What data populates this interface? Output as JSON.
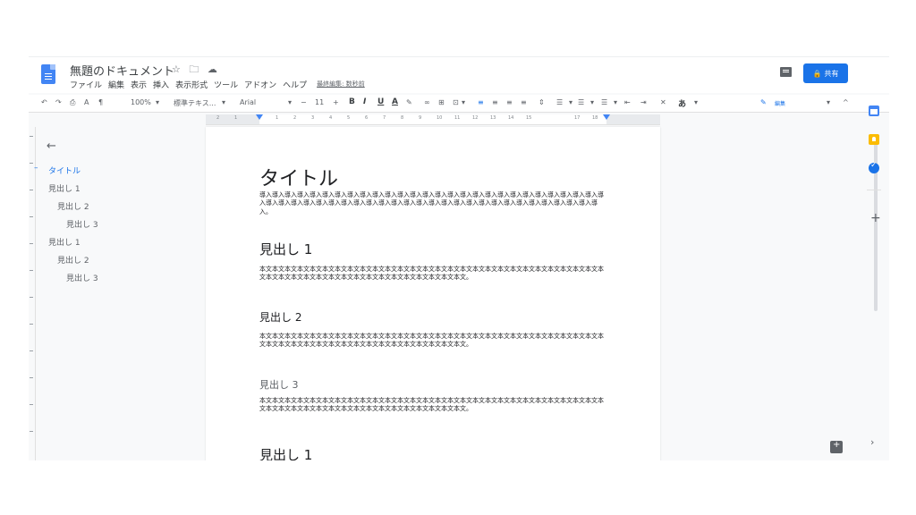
{
  "header": {
    "title": "無題のドキュメント",
    "star_icon": "☆",
    "folder_icon": "🗀",
    "cloud_icon": "☁",
    "menu": [
      "ファイル",
      "編集",
      "表示",
      "挿入",
      "表示形式",
      "ツール",
      "アドオン",
      "ヘルプ"
    ],
    "last_edit": "最終編集: 数秒前",
    "share_label": "共有",
    "accent_color": "#1a73e8"
  },
  "toolbar": {
    "zoom": "100%",
    "style": "標準テキス...",
    "font": "Arial",
    "font_size": "11",
    "bold": "B",
    "italic": "I",
    "underline": "U",
    "text_color": "A",
    "input_mode": "あ",
    "mode": "編集"
  },
  "ruler": {
    "numbers": [
      "2",
      "1",
      "1",
      "2",
      "3",
      "4",
      "5",
      "6",
      "7",
      "8",
      "9",
      "10",
      "11",
      "12",
      "13",
      "14",
      "15",
      "17",
      "18"
    ]
  },
  "outline": {
    "items": [
      {
        "label": "タイトル",
        "level": 0,
        "active": true
      },
      {
        "label": "見出し 1",
        "level": 1,
        "active": false
      },
      {
        "label": "見出し 2",
        "level": 2,
        "active": false
      },
      {
        "label": "見出し 3",
        "level": 3,
        "active": false
      },
      {
        "label": "見出し 1",
        "level": 1,
        "active": false
      },
      {
        "label": "見出し 2",
        "level": 2,
        "active": false
      },
      {
        "label": "見出し 3",
        "level": 3,
        "active": false
      }
    ]
  },
  "document": {
    "title": "タイトル",
    "title_body": "導入導入導入導入導入導入導入導入導入導入導入導入導入導入導入導入導入導入導入導入導入導入導入導入導入導入導入導入導入導入導入導入導入導入導入導入導入導入導入導入導入導入導入導入導入導入導入導入導入導入導入導入導入導入導入。",
    "h1": "見出し 1",
    "h1_body": "本文本文本文本文本文本文本文本文本文本文本文本文本文本文本文本文本文本文本文本文本文本文本文本文本文本文本文本文本文本文本文本文本文本文本文本文本文本文本文本文本文本文本文本文。",
    "h2": "見出し 2",
    "h2_body": "本文本文本文本文本文本文本文本文本文本文本文本文本文本文本文本文本文本文本文本文本文本文本文本文本文本文本文本文本文本文本文本文本文本文本文本文本文本文本文本文本文本文本文本文。",
    "h3": "見出し 3",
    "h3_body": "本文本文本文本文本文本文本文本文本文本文本文本文本文本文本文本文本文本文本文本文本文本文本文本文本文本文本文本文本文本文本文本文本文本文本文本文本文本文本文本文本文本文本文本文。",
    "h1b": "見出し 1"
  }
}
